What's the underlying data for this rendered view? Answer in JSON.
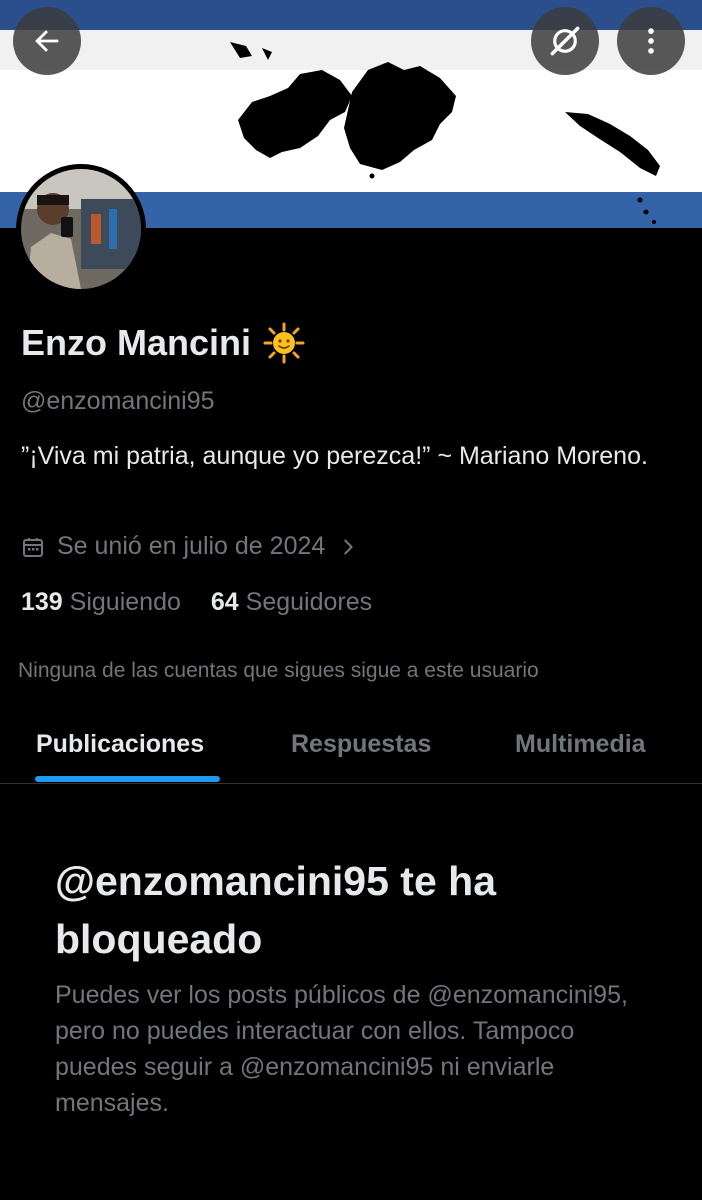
{
  "header": {
    "back_icon": "arrow-left-icon",
    "grok_icon": "grok-icon",
    "more_icon": "more-vertical-icon"
  },
  "banner": {
    "colors": {
      "top_stripe": "#3563a8",
      "middle": "#ffffff",
      "bottom_stripe": "#3563a8",
      "map": "#000000"
    }
  },
  "profile": {
    "name": "Enzo Mancini",
    "name_emoji": "🌞",
    "handle": "@enzomancini95",
    "bio": "”¡Viva mi patria, aunque yo perezca!” ~ Mariano Moreno.",
    "joined": "Se unió en julio de 2024",
    "following_count": "139",
    "following_label": "Siguiendo",
    "followers_count": "64",
    "followers_label": "Seguidores",
    "mutuals_text": "Ninguna de las cuentas que sigues sigue a este usuario"
  },
  "tabs": [
    {
      "label": "Publicaciones",
      "active": true
    },
    {
      "label": "Respuestas",
      "active": false
    },
    {
      "label": "Multimedia",
      "active": false
    }
  ],
  "blocked": {
    "title": "@enzomancini95 te ha bloqueado",
    "body": "Puedes ver los posts públicos de @enzomancini95, pero no puedes interactuar con ellos. Tampoco puedes seguir a @enzomancini95 ni enviarle mensajes."
  },
  "colors": {
    "accent": "#1d9bf0",
    "background": "#000000",
    "text": "#e7e9ea",
    "secondary_text": "#71767b"
  }
}
